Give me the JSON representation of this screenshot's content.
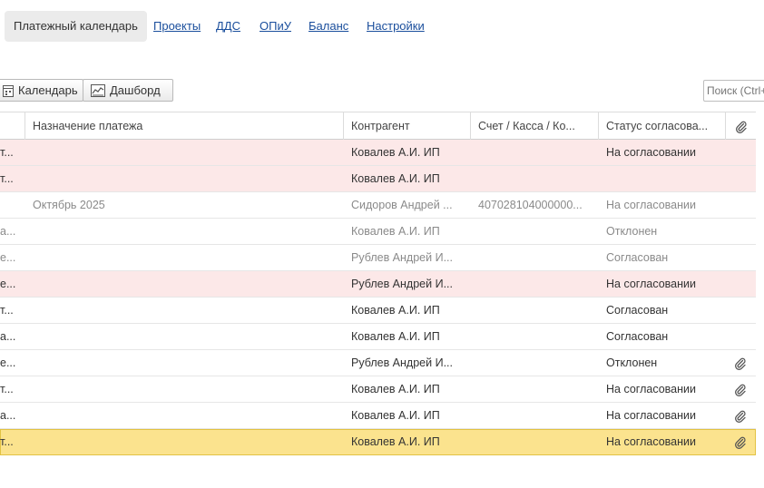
{
  "nav": {
    "active": "Платежный календарь",
    "links": [
      "Проекты",
      "ДДС",
      "ОПиУ",
      "Баланс",
      "Настройки"
    ]
  },
  "toolbar": {
    "calendar_label": "Календарь",
    "dashboard_label": "Дашборд",
    "search_placeholder": "Поиск (Ctrl+F)"
  },
  "table": {
    "headers": [
      "Назначение платежа",
      "Контрагент",
      "Счет / Касса / Ко...",
      "Статус согласова..."
    ],
    "rows": [
      {
        "c0": "т...",
        "purpose": "",
        "contractor": "Ковалев А.И. ИП",
        "account": "",
        "status": "На согласовании",
        "clip": false,
        "style": "pink"
      },
      {
        "c0": "т...",
        "purpose": "",
        "contractor": "Ковалев А.И. ИП",
        "account": "",
        "status": "",
        "clip": false,
        "style": "pink"
      },
      {
        "c0": "",
        "purpose": "Октябрь 2025",
        "contractor": "Сидоров Андрей ...",
        "account": "407028104000000...",
        "status": "На согласовании",
        "clip": false,
        "style": "muted"
      },
      {
        "c0": "а...",
        "purpose": "",
        "contractor": "Ковалев А.И. ИП",
        "account": "",
        "status": "Отклонен",
        "clip": false,
        "style": "muted"
      },
      {
        "c0": "е...",
        "purpose": "",
        "contractor": "Рублев Андрей И...",
        "account": "",
        "status": "Согласован",
        "clip": false,
        "style": "muted"
      },
      {
        "c0": "е...",
        "purpose": "",
        "contractor": "Рублев Андрей И...",
        "account": "",
        "status": "На согласовании",
        "clip": false,
        "style": "pink"
      },
      {
        "c0": "т...",
        "purpose": "",
        "contractor": "Ковалев А.И. ИП",
        "account": "",
        "status": "Согласован",
        "clip": false,
        "style": ""
      },
      {
        "c0": "а...",
        "purpose": "",
        "contractor": "Ковалев А.И. ИП",
        "account": "",
        "status": "Согласован",
        "clip": false,
        "style": ""
      },
      {
        "c0": "е...",
        "purpose": "",
        "contractor": "Рублев Андрей И...",
        "account": "",
        "status": "Отклонен",
        "clip": true,
        "style": ""
      },
      {
        "c0": "т...",
        "purpose": "",
        "contractor": "Ковалев А.И. ИП",
        "account": "",
        "status": "На согласовании",
        "clip": true,
        "style": ""
      },
      {
        "c0": "а...",
        "purpose": "",
        "contractor": "Ковалев А.И. ИП",
        "account": "",
        "status": "На согласовании",
        "clip": true,
        "style": ""
      },
      {
        "c0": "т...",
        "purpose": "",
        "contractor": "Ковалев А.И. ИП",
        "account": "",
        "status": "На согласовании",
        "clip": true,
        "style": "sel"
      }
    ]
  },
  "colors": {
    "link": "#1a4e9c",
    "row_pink": "#fce8e8",
    "row_selected": "#fbe38e",
    "muted_text": "#8a8a8a"
  }
}
